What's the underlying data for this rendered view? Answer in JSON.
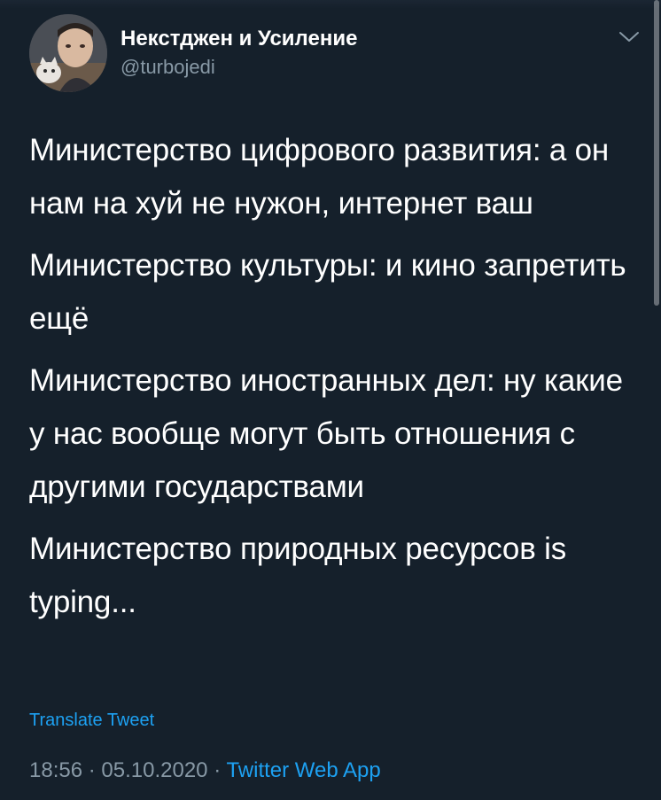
{
  "tweet": {
    "author": {
      "display_name": "Некстджен и Усиление",
      "handle": "@turbojedi"
    },
    "paragraphs": [
      "Министерство цифрового развития: а он нам на хуй не нужон, интернет ваш",
      "Министерство культуры: и кино запретить ещё",
      "Министерство иностранных дел: ну какие у нас вообще могут быть отношения с другими государствами",
      "Министерство природных ресурсов is typing..."
    ],
    "translate_label": "Translate Tweet",
    "time": "18:56",
    "date": "05.10.2020",
    "separator": "·",
    "source": "Twitter Web App"
  },
  "icons": {
    "menu": "chevron-down-icon",
    "avatar": "avatar"
  },
  "colors": {
    "background": "#15202b",
    "primary_text": "#ffffff",
    "secondary_text": "#8899a6",
    "accent": "#1da1f2"
  }
}
